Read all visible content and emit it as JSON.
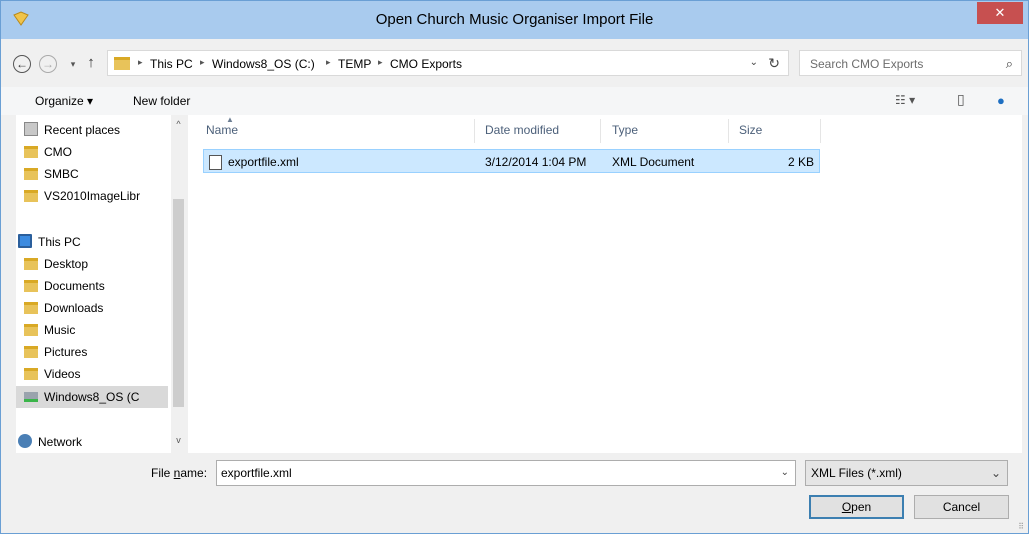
{
  "window": {
    "title": "Open Church Music Organiser Import File",
    "close_glyph": "✕"
  },
  "nav_buttons": {
    "back": "←",
    "forward": "→",
    "recent": "▾",
    "up": "↑"
  },
  "address": {
    "crumbs": [
      "This PC",
      "Windows8_OS (C:)",
      "TEMP",
      "CMO Exports"
    ],
    "separator": "▸",
    "dropdown": "⌄",
    "refresh": "↻"
  },
  "search": {
    "placeholder": "Search CMO Exports",
    "icon": "⌕"
  },
  "toolbar": {
    "organize_label": "Organize ▾",
    "new_folder_label": "New folder",
    "view_icon": "☷ ▾",
    "preview_icon": "▯",
    "help_icon": "●"
  },
  "sidebar": {
    "items": [
      {
        "label": "Recent places",
        "icon": "recent-places-icon"
      },
      {
        "label": "CMO",
        "icon": "folder-icon"
      },
      {
        "label": "SMBC",
        "icon": "folder-icon"
      },
      {
        "label": "VS2010ImageLibr",
        "icon": "folder-icon"
      },
      {
        "label": "This PC",
        "icon": "pc-icon"
      },
      {
        "label": "Desktop",
        "icon": "folder-icon"
      },
      {
        "label": "Documents",
        "icon": "folder-icon"
      },
      {
        "label": "Downloads",
        "icon": "folder-icon"
      },
      {
        "label": "Music",
        "icon": "folder-icon"
      },
      {
        "label": "Pictures",
        "icon": "folder-icon"
      },
      {
        "label": "Videos",
        "icon": "folder-icon"
      },
      {
        "label": "Windows8_OS (C",
        "icon": "drive-icon"
      },
      {
        "label": "Network",
        "icon": "network-icon"
      }
    ],
    "scroll_up": "^",
    "scroll_down": "v"
  },
  "columns": {
    "name": "Name",
    "date_modified": "Date modified",
    "type": "Type",
    "size": "Size",
    "sort_indicator": "▲"
  },
  "files": [
    {
      "name": "exportfile.xml",
      "date_modified": "3/12/2014 1:04 PM",
      "type": "XML Document",
      "size": "2 KB"
    }
  ],
  "footer": {
    "file_name_label_pre": "File ",
    "file_name_label_underlined": "n",
    "file_name_label_post": "ame:",
    "file_name_value": "exportfile.xml",
    "file_name_dropdown": "⌄",
    "file_type": "XML Files (*.xml)",
    "file_type_dropdown": "⌄",
    "open_underlined": "O",
    "open_rest": "pen",
    "cancel_label": "Cancel",
    "grip": "⠿"
  }
}
